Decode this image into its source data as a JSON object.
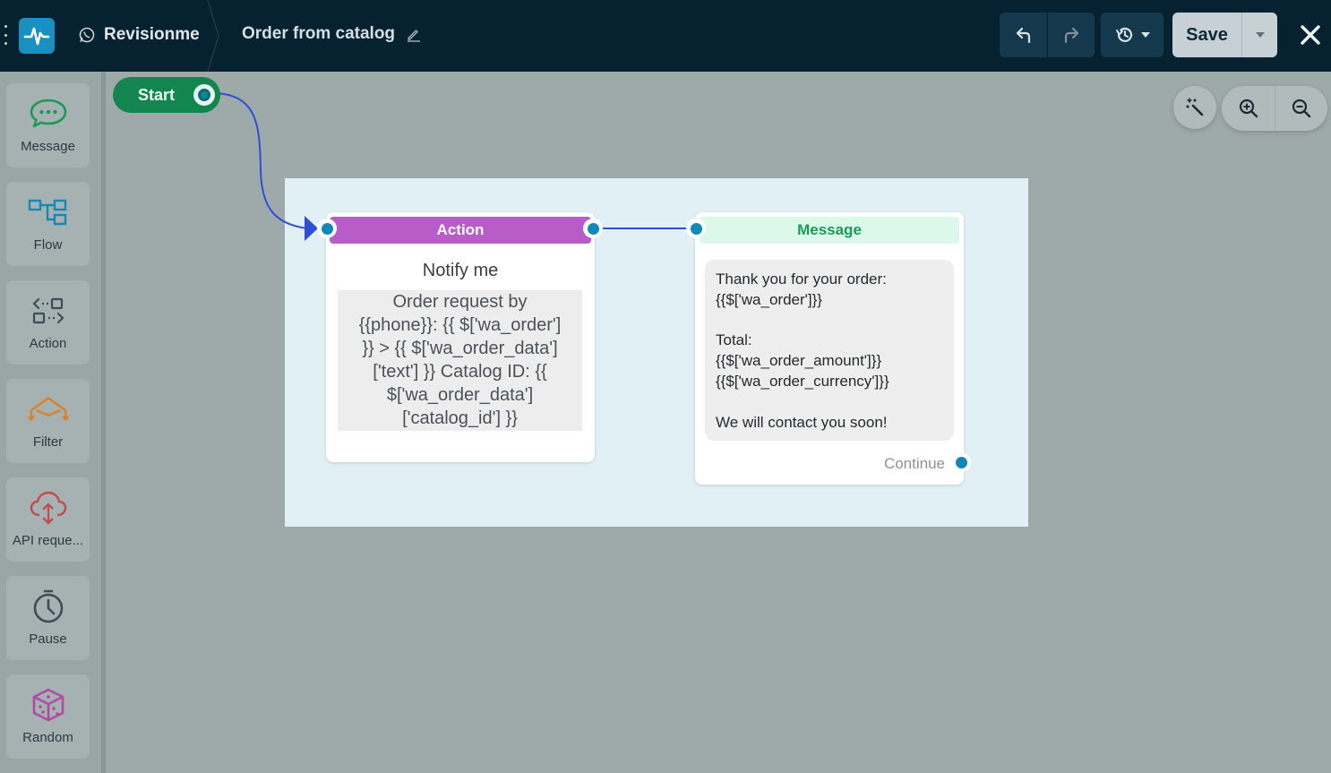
{
  "app": {
    "project_name": "Revisionme",
    "flow_title": "Order from catalog"
  },
  "toolbar": {
    "save_label": "Save",
    "icons": [
      "undo-icon",
      "redo-icon",
      "history-icon",
      "chevron-down-icon",
      "close-icon"
    ]
  },
  "sidebar": {
    "items": [
      {
        "label": "Message",
        "icon": "message-icon",
        "color": "#1b9a55"
      },
      {
        "label": "Flow",
        "icon": "flow-icon",
        "color": "#1588b8"
      },
      {
        "label": "Action",
        "icon": "action-icon",
        "color": "#3b4f5a"
      },
      {
        "label": "Filter",
        "icon": "filter-icon",
        "color": "#d9822b"
      },
      {
        "label": "API reque...",
        "icon": "api-icon",
        "color": "#c44b4b"
      },
      {
        "label": "Pause",
        "icon": "pause-clock-icon",
        "color": "#3b4f5a"
      },
      {
        "label": "Random",
        "icon": "dice-icon",
        "color": "#b04aa6"
      }
    ]
  },
  "canvas": {
    "start_label": "Start",
    "action_node": {
      "header": "Action",
      "title": "Notify me",
      "body_lines": [
        "Order request by",
        "{{phone}}: {{ $['wa_order']",
        "}} > {{ $['wa_order_data']",
        "['text'] }} Catalog ID: {{",
        "$['wa_order_data']",
        "['catalog_id'] }}"
      ],
      "header_color": "#b85cc8"
    },
    "message_node": {
      "header": "Message",
      "lines": [
        "Thank you for your order:",
        "{{$['wa_order']}}",
        "",
        "Total:",
        "{{$['wa_order_amount']}}",
        "{{$['wa_order_currency']}}",
        "",
        "We will contact you soon!"
      ],
      "continue_label": "Continue",
      "header_color": "#1a9a56"
    },
    "tools": [
      "magic-wand-icon",
      "zoom-in-icon",
      "zoom-out-icon"
    ]
  }
}
